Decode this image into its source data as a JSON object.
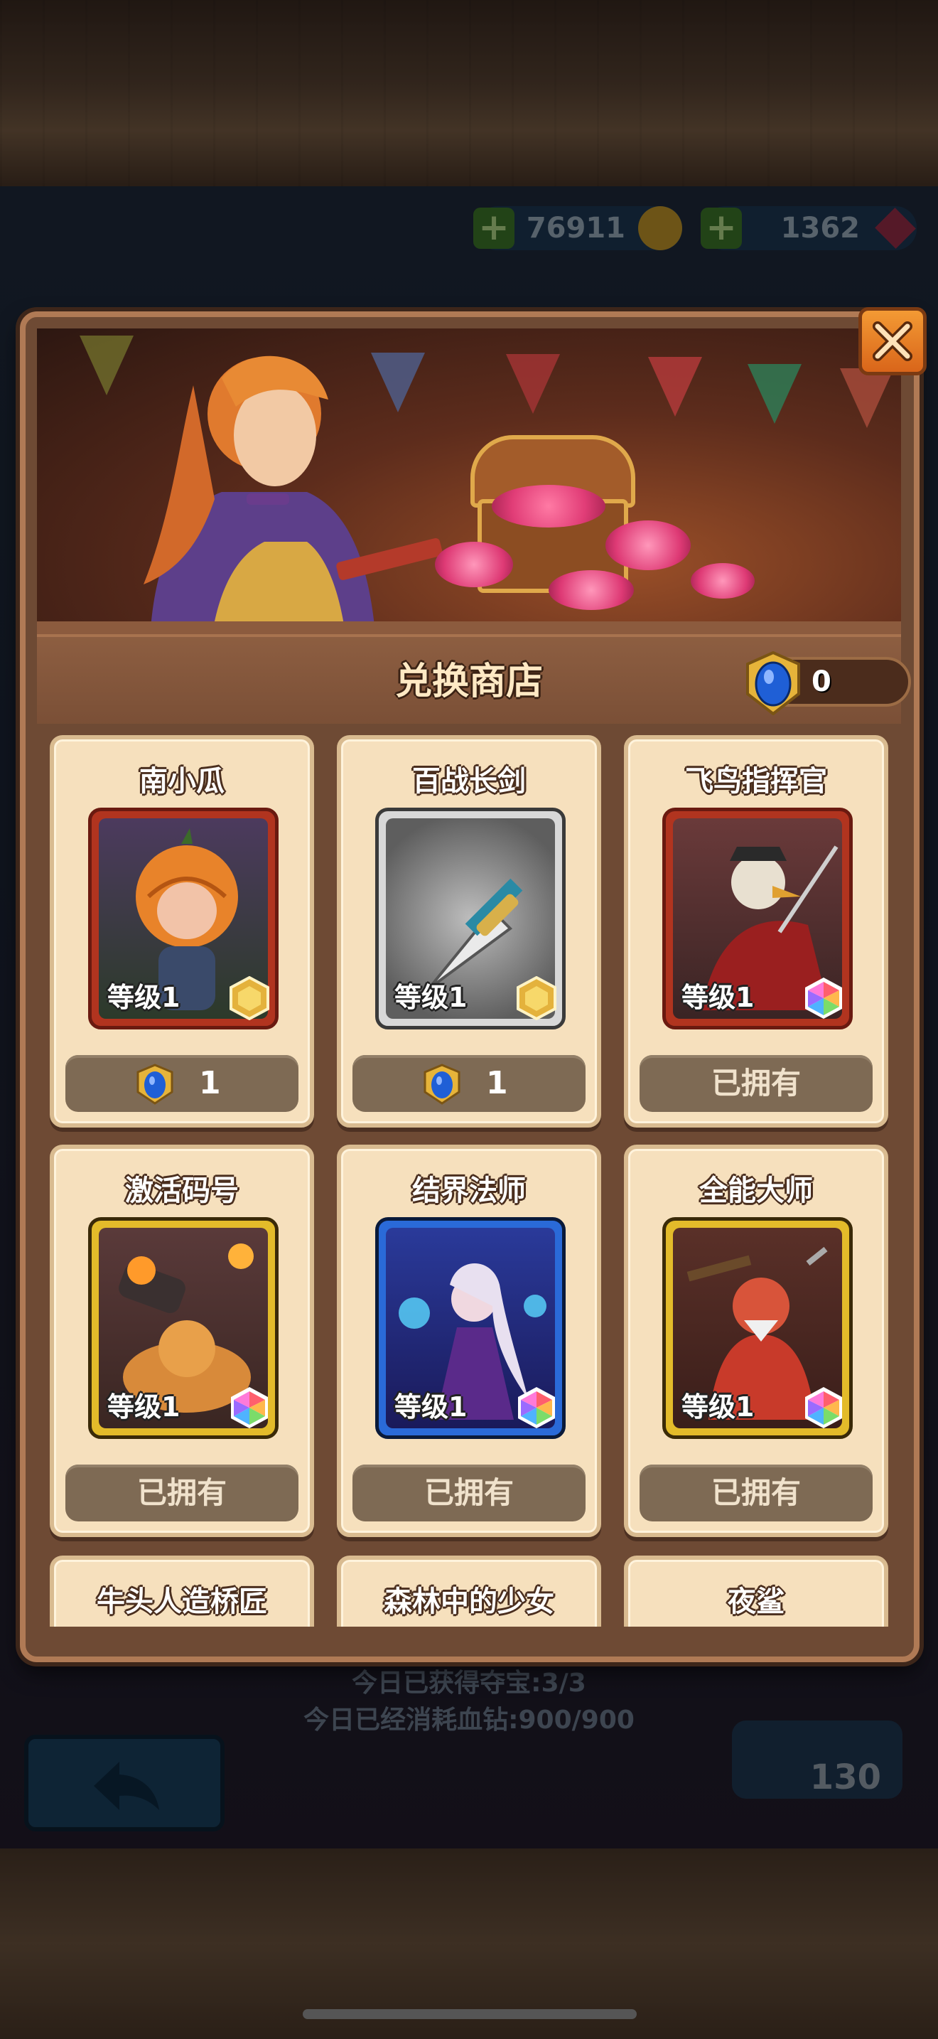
{
  "currency": {
    "coins": "76911",
    "gems": "1362",
    "add_symbol": "+"
  },
  "background": {
    "status_line_1": "今日已获得夺宝:3/3",
    "status_line_2": "今日已经消耗血钻:900/900",
    "bottom_counter": "130"
  },
  "shop": {
    "title": "兑换商店",
    "token_balance": "0",
    "items": [
      {
        "name": "南小瓜",
        "level": "等级1",
        "tier": "gold",
        "action": "price",
        "price": "1",
        "owned_label": ""
      },
      {
        "name": "百战长剑",
        "level": "等级1",
        "tier": "gold",
        "action": "price",
        "price": "1",
        "owned_label": ""
      },
      {
        "name": "飞鸟指挥官",
        "level": "等级1",
        "tier": "rainbow",
        "action": "owned",
        "price": "",
        "owned_label": "已拥有"
      },
      {
        "name": "激活码号",
        "level": "等级1",
        "tier": "rainbow",
        "action": "owned",
        "price": "",
        "owned_label": "已拥有"
      },
      {
        "name": "结界法师",
        "level": "等级1",
        "tier": "rainbow",
        "action": "owned",
        "price": "",
        "owned_label": "已拥有"
      },
      {
        "name": "全能大师",
        "level": "等级1",
        "tier": "rainbow",
        "action": "owned",
        "price": "",
        "owned_label": "已拥有"
      },
      {
        "name": "牛头人造桥匠",
        "level": "",
        "tier": "",
        "action": "",
        "price": "",
        "owned_label": ""
      },
      {
        "name": "森林中的少女",
        "level": "",
        "tier": "",
        "action": "",
        "price": "",
        "owned_label": ""
      },
      {
        "name": "夜鲨",
        "level": "",
        "tier": "",
        "action": "",
        "price": "",
        "owned_label": ""
      }
    ]
  },
  "icons": {
    "close": "close-icon",
    "back": "back-arrow-icon",
    "token": "blue-token-icon",
    "tier_gold": "gold-hexagon-icon",
    "tier_rainbow": "rainbow-hexagon-icon"
  },
  "colors": {
    "frame_brown": "#6e4a34",
    "card_bg": "#f6e0bd",
    "button_bg": "#7e6a54",
    "close_orange": "#e8801f",
    "token_blue": "#1f5fd6"
  }
}
